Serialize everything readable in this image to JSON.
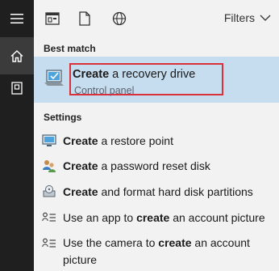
{
  "colors": {
    "rail_bg": "#1f1f1f",
    "rail_active": "#3b3b3b",
    "panel_bg": "#f2f2f2",
    "selected_bg": "#c6dcef",
    "highlight_border": "#d9303a"
  },
  "rail": {
    "icons": [
      "hamburger-menu-icon",
      "home-icon",
      "notebook-icon"
    ]
  },
  "toolbar": {
    "icons": [
      "apps-icon",
      "documents-icon",
      "web-icon"
    ],
    "filters_label": "Filters"
  },
  "best_match": {
    "header": "Best match",
    "title_bold": "Create",
    "title_rest": " a recovery drive",
    "subtitle": "Control panel",
    "icon": "recovery-drive-icon"
  },
  "settings": {
    "header": "Settings",
    "items": [
      {
        "pre": "",
        "bold": "Create",
        "post": " a restore point",
        "icon": "monitor-icon"
      },
      {
        "pre": "",
        "bold": "Create",
        "post": " a password reset disk",
        "icon": "users-icon"
      },
      {
        "pre": "",
        "bold": "Create",
        "post": " and format hard disk partitions",
        "icon": "disk-partition-icon"
      },
      {
        "pre": "Use an app to ",
        "bold": "create",
        "post": " an account picture",
        "icon": "account-list-icon"
      },
      {
        "pre": "Use the camera to ",
        "bold": "create",
        "post": " an account picture",
        "icon": "account-list-icon"
      }
    ]
  }
}
